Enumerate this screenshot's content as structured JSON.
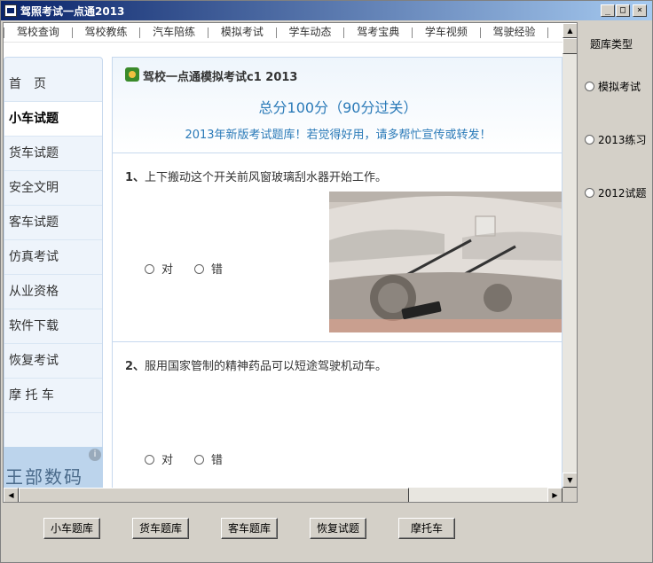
{
  "window": {
    "title": "驾照考试一点通2013",
    "minimize": "_",
    "maximize": "□",
    "close": "×"
  },
  "navbar": {
    "items": [
      "驾校查询",
      "驾校教练",
      "汽车陪练",
      "模拟考试",
      "学车动态",
      "驾考宝典",
      "学车视频",
      "驾驶经验"
    ]
  },
  "sidebar": {
    "items": [
      "首　页",
      "小车试题",
      "货车试题",
      "安全文明",
      "客车试题",
      "仿真考试",
      "从业资格",
      "软件下载",
      "恢复考试",
      "摩 托 车"
    ],
    "ad_text": "王部数码"
  },
  "exam": {
    "title": "驾校一点通模拟考试c1 2013",
    "score": "总分100分（90分过关）",
    "note": "2013年新版考试题库！若觉得好用，请多帮忙宣传或转发！"
  },
  "questions": [
    {
      "num": "1、",
      "text": "上下搬动这个开关前风窗玻璃刮水器开始工作。",
      "options": [
        "对",
        "错"
      ]
    },
    {
      "num": "2、",
      "text": "服用国家管制的精神药品可以短途驾驶机动车。",
      "options": [
        "对",
        "错"
      ]
    }
  ],
  "right_panel": {
    "title": "题库类型",
    "options": [
      "模拟考试",
      "2013练习",
      "2012试题"
    ]
  },
  "bottom_buttons": [
    "小车题库",
    "货车题库",
    "客车题库",
    "恢复试题",
    "摩托车"
  ],
  "colors": {
    "accent_blue": "#2a7ab8",
    "titlebar": "#0a246a",
    "panel_bg": "#d4d0c8"
  }
}
